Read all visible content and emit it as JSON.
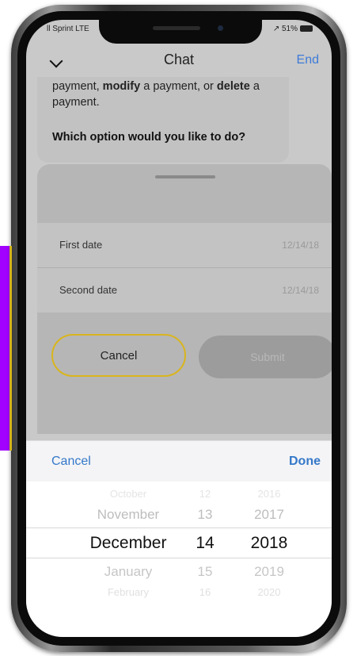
{
  "status_bar": {
    "carrier": "ll Sprint LTE",
    "battery": "↗ 51%"
  },
  "header": {
    "title": "Chat",
    "end_label": "End"
  },
  "chat": {
    "message_lines": [
      "payment, modify a payment, or delete a",
      "payment."
    ],
    "question": "Which option would you like to do?"
  },
  "form": {
    "first_date_label": "First date",
    "first_date_value": "12/14/18",
    "second_date_label": "Second date",
    "second_date_value": "12/14/18",
    "cancel_label": "Cancel",
    "submit_label": "Submit"
  },
  "picker": {
    "cancel_label": "Cancel",
    "done_label": "Done",
    "months": [
      "October",
      "November",
      "December",
      "January",
      "February"
    ],
    "days": [
      "12",
      "13",
      "14",
      "15",
      "16"
    ],
    "years": [
      "2016",
      "2017",
      "2018",
      "2019",
      "2020"
    ],
    "selected": {
      "month": "December",
      "day": "14",
      "year": "2018"
    }
  },
  "colors": {
    "accent": "#d9b51d",
    "link_blue": "#3478c9",
    "highlight_strip": "#a200ff"
  }
}
